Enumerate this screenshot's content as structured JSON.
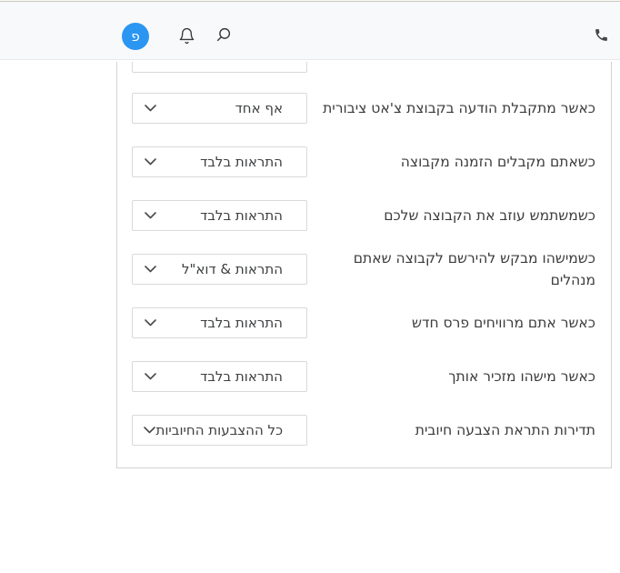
{
  "header": {
    "avatar_letter": "פ",
    "avatar_color": "#2b96f2",
    "icons": {
      "bell": "notifications",
      "search": "search",
      "phone": "phone"
    }
  },
  "settings": {
    "rows": [
      {
        "label": "כאשר מתקבלת הודעה בקבוצת צ'אט ציבורית",
        "value": "אף אחד"
      },
      {
        "label": "כשאתם מקבלים הזמנה מקבוצה",
        "value": "התראות בלבד"
      },
      {
        "label": "כשמשתמש עוזב את הקבוצה שלכם",
        "value": "התראות בלבד"
      },
      {
        "label": "כשמישהו מבקש להירשם לקבוצה שאתם\nמנהלים",
        "value": "התראות & דוא\"ל"
      },
      {
        "label": "כאשר אתם מרוויחים פרס חדש",
        "value": "התראות בלבד"
      },
      {
        "label": "כאשר מישהו מזכיר אותך",
        "value": "התראות בלבד"
      },
      {
        "label": "תדירות התראת הצבעה חיובית",
        "value": "כל ההצבעות החיוביות"
      }
    ]
  }
}
